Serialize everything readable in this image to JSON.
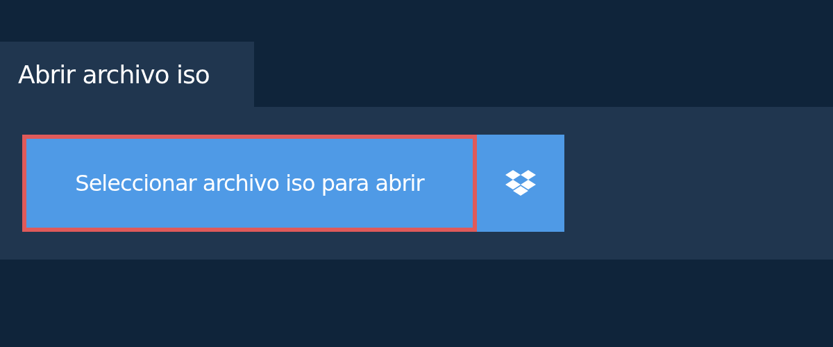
{
  "tab": {
    "label": "Abrir archivo iso"
  },
  "select_button": {
    "label": "Seleccionar archivo iso para abrir",
    "highlighted": true
  }
}
